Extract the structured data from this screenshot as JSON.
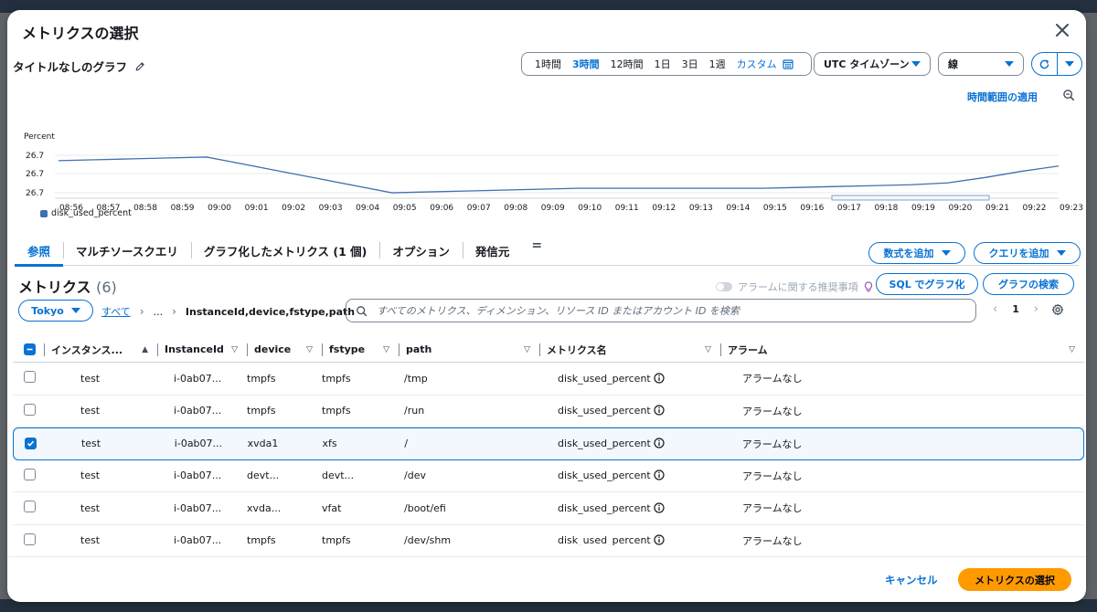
{
  "modal": {
    "title": "メトリクスの選択",
    "graph_title": "タイトルなしのグラフ"
  },
  "time_range": {
    "items": [
      {
        "label": "1時間",
        "active": false
      },
      {
        "label": "3時間",
        "active": true
      },
      {
        "label": "12時間",
        "active": false
      },
      {
        "label": "1日",
        "active": false
      },
      {
        "label": "3日",
        "active": false
      },
      {
        "label": "1週",
        "active": false
      }
    ],
    "custom_label": "カスタム",
    "timezone": "UTC タイムゾーン",
    "chart_style": "線",
    "apply_link": "時間範囲の適用"
  },
  "chart_data": {
    "type": "line",
    "ylabel": "Percent",
    "y_ticks": [
      "26.7",
      "26.7",
      "26.7"
    ],
    "categories": [
      "08:56",
      "08:57",
      "08:58",
      "08:59",
      "09:00",
      "09:01",
      "09:02",
      "09:03",
      "09:04",
      "09:05",
      "09:06",
      "09:07",
      "09:08",
      "09:09",
      "09:10",
      "09:11",
      "09:12",
      "09:13",
      "09:14",
      "09:15",
      "09:16",
      "09:17",
      "09:18",
      "09:19",
      "09:20",
      "09:21",
      "09:22",
      "09:23"
    ],
    "series": [
      {
        "name": "disk_used_percent",
        "color": "#3f6fb0",
        "values": [
          26.728,
          26.729,
          26.73,
          26.731,
          26.732,
          26.724,
          26.716,
          26.708,
          26.7,
          26.692,
          26.693,
          26.694,
          26.695,
          26.696,
          26.697,
          26.697,
          26.697,
          26.697,
          26.697,
          26.697,
          26.698,
          26.699,
          26.7,
          26.701,
          26.703,
          26.709,
          26.716,
          26.722
        ]
      }
    ],
    "ylim": [
      26.69,
      26.735
    ],
    "grid": true
  },
  "tabs": [
    {
      "label": "参照",
      "active": true
    },
    {
      "label": "マルチソースクエリ",
      "active": false
    },
    {
      "label": "グラフ化したメトリクス (1 個)",
      "active": false
    },
    {
      "label": "オプション",
      "active": false
    },
    {
      "label": "発信元",
      "active": false
    }
  ],
  "actions": {
    "add_formula": "数式を追加",
    "add_query": "クエリを追加",
    "sql_graph": "SQL でグラフ化",
    "graph_search": "グラフの検索",
    "alarm_recommend": "アラームに関する推奨事項"
  },
  "metrics": {
    "title": "メトリクス",
    "count": "(6)",
    "region": "Tokyo",
    "crumb_all": "すべて",
    "crumb_ellipsis": "...",
    "crumb_current": "InstanceId,device,fstype,path",
    "search_placeholder": "すべてのメトリクス、ディメンション、リソース ID またはアカウント ID を検索",
    "page": "1"
  },
  "table": {
    "columns": [
      "インスタンス...",
      "InstanceId",
      "device",
      "fstype",
      "path",
      "メトリクス名",
      "アラーム"
    ],
    "rows": [
      {
        "checked": false,
        "name": "test",
        "instance": "i-0ab07...",
        "device": "tmpfs",
        "fstype": "tmpfs",
        "path": "/tmp",
        "metric": "disk_used_percent",
        "alarm": "アラームなし"
      },
      {
        "checked": false,
        "name": "test",
        "instance": "i-0ab07...",
        "device": "tmpfs",
        "fstype": "tmpfs",
        "path": "/run",
        "metric": "disk_used_percent",
        "alarm": "アラームなし"
      },
      {
        "checked": true,
        "name": "test",
        "instance": "i-0ab07...",
        "device": "xvda1",
        "fstype": "xfs",
        "path": "/",
        "metric": "disk_used_percent",
        "alarm": "アラームなし"
      },
      {
        "checked": false,
        "name": "test",
        "instance": "i-0ab07...",
        "device": "devt...",
        "fstype": "devt...",
        "path": "/dev",
        "metric": "disk_used_percent",
        "alarm": "アラームなし"
      },
      {
        "checked": false,
        "name": "test",
        "instance": "i-0ab07...",
        "device": "xvda...",
        "fstype": "vfat",
        "path": "/boot/efi",
        "metric": "disk_used_percent",
        "alarm": "アラームなし"
      },
      {
        "checked": false,
        "name": "test",
        "instance": "i-0ab07...",
        "device": "tmpfs",
        "fstype": "tmpfs",
        "path": "/dev/shm",
        "metric": "disk_used_percent",
        "alarm": "アラームなし"
      }
    ]
  },
  "footer": {
    "cancel": "キャンセル",
    "primary": "メトリクスの選択"
  },
  "colors": {
    "accent": "#0972d3",
    "primary_button": "#ff9900",
    "series": "#3f6fb0"
  }
}
